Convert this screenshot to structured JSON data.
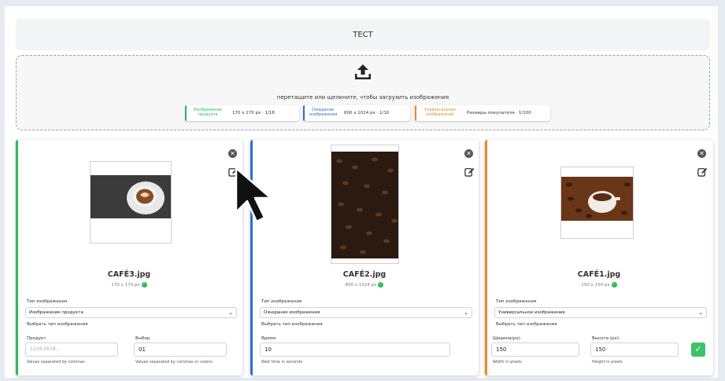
{
  "header": {
    "title": "ТЕСТ"
  },
  "dropzone": {
    "instruction": "перетащите или щелкните, чтобы загрузить изображения",
    "chips": [
      {
        "label": "Изображение продукта",
        "value": "170 x 170 px · 1/18",
        "color": "#2eb85c"
      },
      {
        "label": "Ожидание изображения",
        "value": "600 x 1024 px · 1/10",
        "color": "#2d6fd1"
      },
      {
        "label": "Универсальное изображение",
        "value": "Размеры покупателя · 1/100",
        "color": "#e58a2c"
      }
    ]
  },
  "cards": [
    {
      "filename": "CAFÉ3.jpg",
      "dims": "170 x 170 px",
      "accent": "#2eb85c",
      "type_label": "Тип изображения",
      "type_value": "Изображение продукта",
      "type_hint": "Выбрать тип изображения",
      "fields": [
        {
          "label": "Продукт",
          "value": "",
          "placeholder": "1234,5678...",
          "hint": "Values separated by commas"
        },
        {
          "label": "Выбор",
          "value": "01",
          "placeholder": "",
          "hint": "Values separated by commas or colons"
        }
      ]
    },
    {
      "filename": "CAFÉ2.jpg",
      "dims": "600 x 1024 px",
      "accent": "#2d6fd1",
      "type_label": "Тип изображения",
      "type_value": "Ожидание изображения",
      "type_hint": "Выбрать тип изображения",
      "fields": [
        {
          "label": "Время",
          "value": "10",
          "placeholder": "",
          "hint": "Wait time in seconds"
        }
      ]
    },
    {
      "filename": "CAFÉ1.jpg",
      "dims": "150 x 150 px",
      "accent": "#e58a2c",
      "type_label": "Тип изображения",
      "type_value": "Универсальное изображение",
      "type_hint": "Выбрать тип изображения",
      "fields": [
        {
          "label": "Ширина(px):",
          "value": "150",
          "placeholder": "",
          "hint": "Width in pixels"
        },
        {
          "label": "Высота (px):",
          "value": "150",
          "placeholder": "",
          "hint": "Height in pixels"
        }
      ]
    }
  ],
  "icons": {
    "upload": "upload-icon",
    "close": "close-icon",
    "edit": "edit-icon",
    "check": "check-icon",
    "cursor": "mouse-cursor-icon",
    "chevron": "chevron-down-icon"
  }
}
